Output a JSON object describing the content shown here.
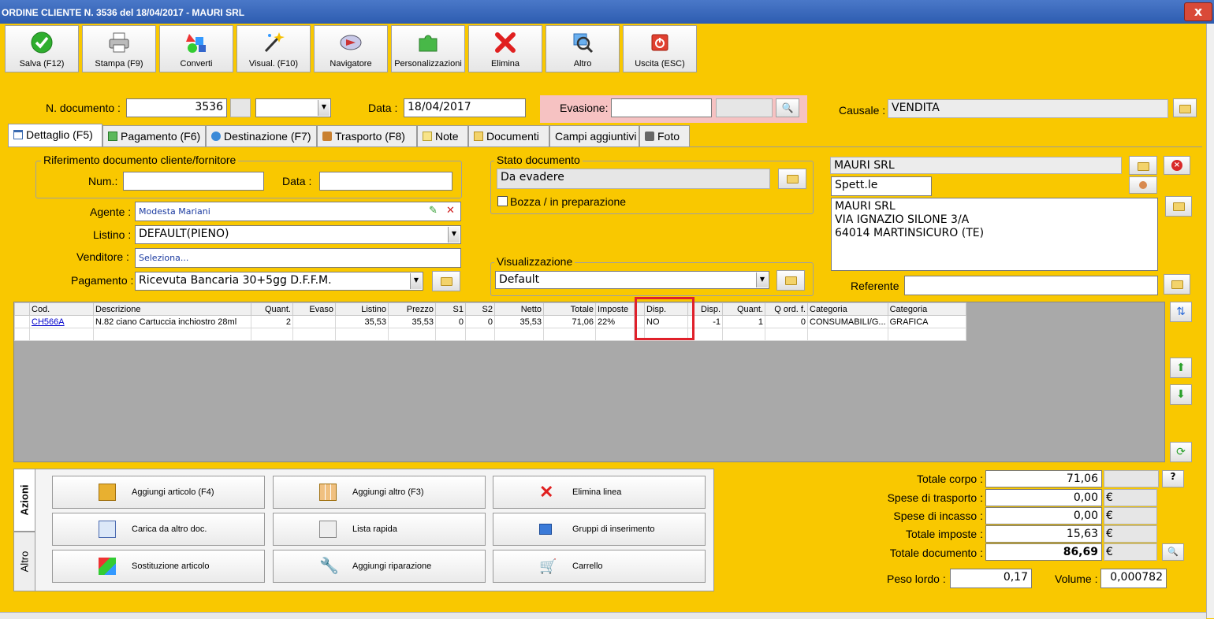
{
  "window": {
    "title": "ORDINE CLIENTE N. 3536 del 18/04/2017 - MAURI SRL",
    "close": "x"
  },
  "toolbar": [
    {
      "label": "Salva (F12)",
      "icon": "check-icon"
    },
    {
      "label": "Stampa (F9)",
      "icon": "printer-icon"
    },
    {
      "label": "Converti",
      "icon": "convert-icon"
    },
    {
      "label": "Visual. (F10)",
      "icon": "magic-wand-icon"
    },
    {
      "label": "Navigatore",
      "icon": "compass-icon"
    },
    {
      "label": "Personalizzazioni",
      "icon": "puzzle-icon"
    },
    {
      "label": "Elimina",
      "icon": "delete-x-icon"
    },
    {
      "label": "Altro",
      "icon": "magnifier-icon"
    },
    {
      "label": "Uscita (ESC)",
      "icon": "power-icon"
    }
  ],
  "header": {
    "ndoc_label": "N. documento :",
    "ndoc_value": "3536",
    "data_label": "Data :",
    "data_value": "18/04/2017",
    "evasione_label": "Evasione:",
    "evasione_value": "",
    "causale_label": "Causale :",
    "causale_value": "VENDITA"
  },
  "tabs": [
    {
      "label": "Dettaglio (F5)",
      "active": true
    },
    {
      "label": "Pagamento (F6)"
    },
    {
      "label": "Destinazione (F7)"
    },
    {
      "label": "Trasporto (F8)"
    },
    {
      "label": "Note"
    },
    {
      "label": "Documenti"
    },
    {
      "label": "Campi aggiuntivi"
    },
    {
      "label": "Foto"
    }
  ],
  "riferimento": {
    "title": "Riferimento documento cliente/fornitore",
    "num_label": "Num.:",
    "num_value": "",
    "data_label": "Data :",
    "data_value": ""
  },
  "fields": {
    "agente_label": "Agente :",
    "agente_value": "Modesta Mariani",
    "listino_label": "Listino :",
    "listino_value": "DEFAULT(PIENO)",
    "venditore_label": "Venditore :",
    "venditore_value": "Seleziona...",
    "pagamento_label": "Pagamento :",
    "pagamento_value": "Ricevuta Bancaria 30+5gg D.F.F.M."
  },
  "stato": {
    "title": "Stato documento",
    "value": "Da evadere",
    "bozza_label": "Bozza / in preparazione"
  },
  "visualizzazione": {
    "title": "Visualizzazione",
    "value": "Default"
  },
  "cliente": {
    "name": "MAURI SRL",
    "title": "Spett.le",
    "address": [
      "MAURI SRL",
      "VIA IGNAZIO SILONE 3/A",
      "64014 MARTINSICURO (TE)"
    ],
    "referente_label": "Referente",
    "referente_value": ""
  },
  "grid": {
    "columns": [
      "Cod.",
      "Descrizione",
      "Quant.",
      "Evaso",
      "Listino",
      "Prezzo",
      "S1",
      "S2",
      "Netto",
      "Totale",
      "Imposte",
      "Disp.",
      "Disp.",
      "Quant.",
      "Q ord. f.",
      "Categoria",
      "Categoria"
    ],
    "rows": [
      [
        "CH566A",
        "N.82 ciano Cartuccia inchiostro 28ml",
        "2",
        "",
        "35,53",
        "35,53",
        "0",
        "0",
        "35,53",
        "71,06",
        "22%",
        "NO",
        "-1",
        "1",
        "0",
        "CONSUMABILI/G...",
        "GRAFICA"
      ]
    ]
  },
  "actions": {
    "vtab_azioni": "Azioni",
    "vtab_altro": "Altro",
    "buttons": [
      {
        "label": "Aggiungi articolo (F4)",
        "icon": "box-add-icon"
      },
      {
        "label": "Aggiungi altro (F3)",
        "icon": "grid-add-icon"
      },
      {
        "label": "Elimina linea",
        "icon": "delete-x-icon"
      },
      {
        "label": "Carica da altro doc.",
        "icon": "table-check-icon"
      },
      {
        "label": "Lista rapida",
        "icon": "list-add-icon"
      },
      {
        "label": "Gruppi di inserimento",
        "icon": "group-add-icon"
      },
      {
        "label": "Sostituzione articolo",
        "icon": "replace-icon"
      },
      {
        "label": "Aggiungi riparazione",
        "icon": "wrench-icon"
      },
      {
        "label": "Carrello",
        "icon": "cart-icon"
      }
    ]
  },
  "totals": {
    "totale_corpo_label": "Totale corpo :",
    "totale_corpo": "71,06",
    "spese_trasporto_label": "Spese di trasporto :",
    "spese_trasporto": "0,00",
    "spese_incasso_label": "Spese di incasso :",
    "spese_incasso": "0,00",
    "totale_imposte_label": "Totale imposte :",
    "totale_imposte": "15,63",
    "totale_documento_label": "Totale documento :",
    "totale_documento": "86,69",
    "euro": "€",
    "help": "?",
    "peso_label": "Peso lordo :",
    "peso_value": "0,17",
    "volume_label": "Volume :",
    "volume_value": "0,000782"
  }
}
